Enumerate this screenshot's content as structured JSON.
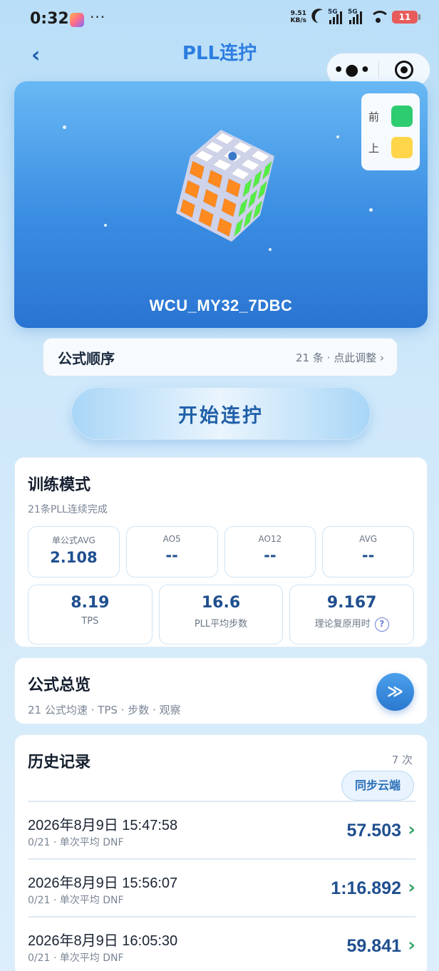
{
  "status_bar": {
    "time": "0:32",
    "more": "···",
    "net_speed_value": "9.51",
    "net_speed_unit": "KB/s",
    "signal1": "5G",
    "signal2": "5G",
    "battery": "11"
  },
  "nav": {
    "title": "PLL连拧",
    "back": "‹",
    "more": "•●•"
  },
  "cube": {
    "device_name": "WCU_MY32_7DBC",
    "orientation": [
      {
        "label": "前",
        "color": "#2ecc71"
      },
      {
        "label": "上",
        "color": "#ffd54a"
      }
    ],
    "colors": {
      "top": "#ffffff",
      "left": "#ff8a1f",
      "right": "#55ee44"
    }
  },
  "formula_order": {
    "title": "公式顺序",
    "count": "21 条",
    "dot": "·",
    "action": "点此调整",
    "chevron": "›"
  },
  "start_button": "开始连拧",
  "training": {
    "title": "训练模式",
    "subtitle": "21条PLL连续完成",
    "stats_row1": [
      {
        "label": "单公式AVG",
        "value": "2.108"
      },
      {
        "label": "AO5",
        "value": "--"
      },
      {
        "label": "AO12",
        "value": "--"
      },
      {
        "label": "AVG",
        "value": "--"
      }
    ],
    "stats_row2": [
      {
        "label": "TPS",
        "value": "8.19"
      },
      {
        "label": "PLL平均步数",
        "value": "16.6"
      },
      {
        "label": "理论复原用时",
        "value": "9.167",
        "help": "?"
      }
    ]
  },
  "overview": {
    "title": "公式总览",
    "subtitle": "21 公式均速 · TPS · 步数 · 观察",
    "button": "≫"
  },
  "history": {
    "title": "历史记录",
    "count": "7 次",
    "sync": "同步云端",
    "records": [
      {
        "datetime": "2026年8月9日 15:47:58",
        "sub": "0/21 · 单次平均 DNF",
        "time": "57.503"
      },
      {
        "datetime": "2026年8月9日 15:56:07",
        "sub": "0/21 · 单次平均 DNF",
        "time": "1:16.892"
      },
      {
        "datetime": "2026年8月9日 16:05:30",
        "sub": "0/21 · 单次平均 DNF",
        "time": "59.841"
      }
    ]
  }
}
